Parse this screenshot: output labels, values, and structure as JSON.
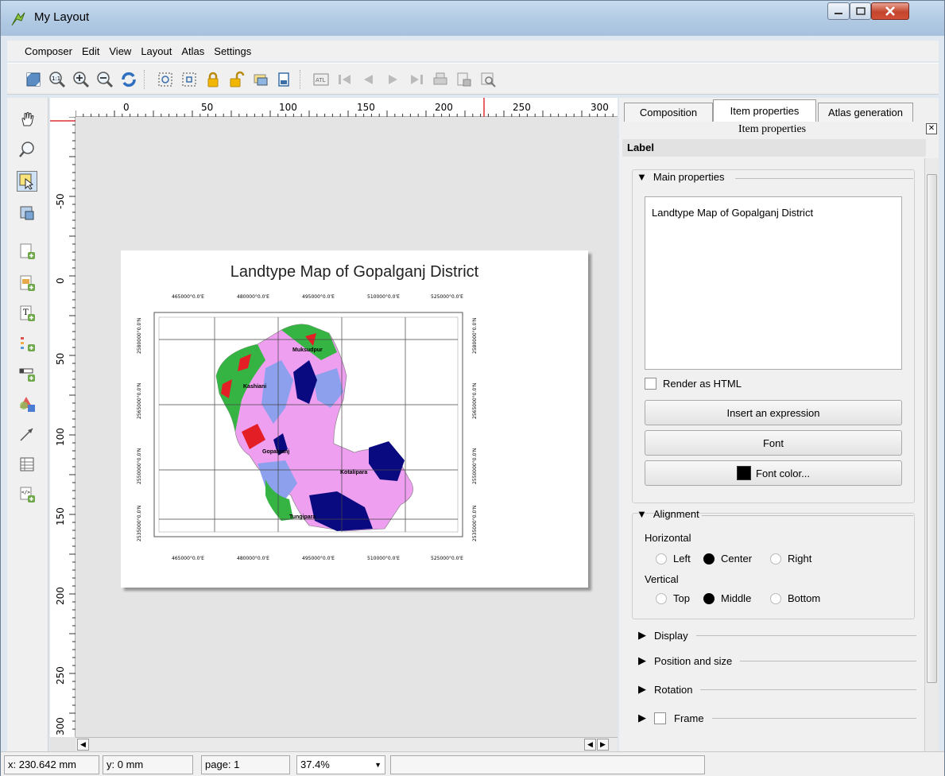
{
  "window": {
    "title": "My Layout"
  },
  "menu": [
    "Composer",
    "Edit",
    "View",
    "Layout",
    "Atlas",
    "Settings"
  ],
  "toolbar_icons": [
    "zoom-full-icon",
    "zoom-actual-icon",
    "zoom-in-icon",
    "zoom-out-icon",
    "refresh-icon",
    "group-icon",
    "ungroup-icon",
    "lock-icon",
    "unlock-icon",
    "raise-icon",
    "align-icon",
    "atlas-preview-icon",
    "first-feature-icon",
    "previous-feature-icon",
    "next-feature-icon",
    "last-feature-icon",
    "print-atlas-icon",
    "export-atlas-icon",
    "atlas-settings-icon"
  ],
  "left_tools": [
    "pan-icon",
    "zoom-tool-icon",
    "select-move-icon",
    "move-content-icon",
    "add-map-icon",
    "add-image-icon",
    "add-label-icon",
    "add-legend-icon",
    "add-scalebar-icon",
    "add-shape-icon",
    "add-arrow-icon",
    "add-table-icon",
    "add-html-icon"
  ],
  "ruler": {
    "top_labels": [
      "0",
      "50",
      "100",
      "150",
      "200",
      "250",
      "300"
    ],
    "left_labels": [
      "-50",
      "0",
      "50",
      "100",
      "150",
      "200",
      "250",
      "300"
    ]
  },
  "map": {
    "title": "Landtype Map of Gopalganj District",
    "top_coords": [
      "465000°0.0'E",
      "480000°0.0'E",
      "495000°0.0'E",
      "510000°0.0'E",
      "525000°0.0'E"
    ],
    "bottom_coords": [
      "465000°0.0'E",
      "480000°0.0'E",
      "495000°0.0'E",
      "510000°0.0'E",
      "525000°0.0'E"
    ],
    "left_coords": [
      "2580000°0.0'N",
      "2565000°0.0'N",
      "2550000°0.0'N",
      "2535000°0.0'N"
    ],
    "places": [
      "Muksudpur",
      "Kashiani",
      "Gopalganj",
      "Kotalipara",
      "Tungipara"
    ]
  },
  "panel": {
    "tabs": [
      "Composition",
      "Item properties",
      "Atlas generation"
    ],
    "dock_title": "Item properties",
    "section": "Label",
    "main_properties": "Main properties",
    "label_text": "Landtype Map of Gopalganj District",
    "render_html": "Render as HTML",
    "insert_expression": "Insert an expression",
    "font": "Font",
    "font_color": "Font color...",
    "alignment": "Alignment",
    "horizontal": "Horizontal",
    "h_options": [
      "Left",
      "Center",
      "Right"
    ],
    "vertical": "Vertical",
    "v_options": [
      "Top",
      "Middle",
      "Bottom"
    ],
    "display": "Display",
    "position_size": "Position and size",
    "rotation": "Rotation",
    "frame": "Frame"
  },
  "status": {
    "x": "x: 230.642 mm",
    "y": "y: 0 mm",
    "page": "page: 1",
    "zoom": "37.4%"
  }
}
